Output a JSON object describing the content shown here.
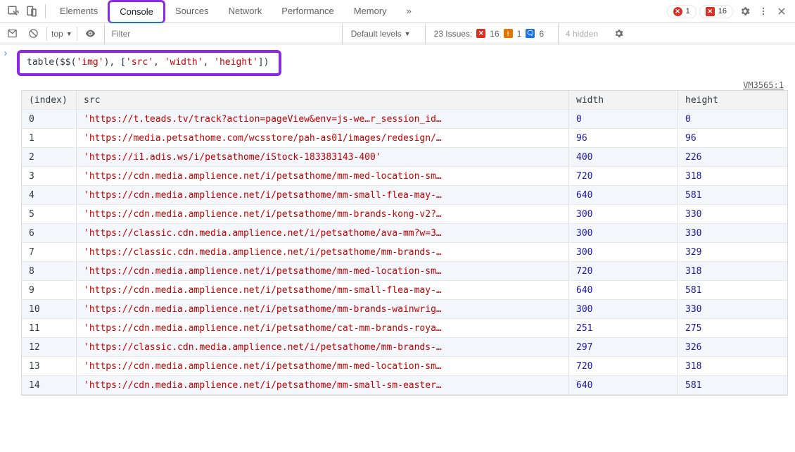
{
  "tabs": {
    "elements": "Elements",
    "console": "Console",
    "sources": "Sources",
    "network": "Network",
    "performance": "Performance",
    "memory": "Memory",
    "more": "»"
  },
  "topPills": {
    "error_count": "1",
    "warn_count": "16"
  },
  "toolbar": {
    "context_label": "top",
    "filter_placeholder": "Filter",
    "levels_label": "Default levels",
    "issues_label": "23 Issues:",
    "issues_err": "16",
    "issues_warn": "1",
    "issues_info": "6",
    "hidden_label": "4 hidden"
  },
  "command": {
    "fn": "table",
    "paren_open": "(",
    "selector_fn": "$$",
    "selector_open": "(",
    "selector_arg": "'img'",
    "selector_close": ")",
    "comma": ", ",
    "arr_open": "[",
    "col1": "'src'",
    "sep1": ", ",
    "col2": "'width'",
    "sep2": ", ",
    "col3": "'height'",
    "arr_close": "]",
    "paren_close": ")"
  },
  "vm_link": "VM3565:1",
  "table": {
    "headers": {
      "index": "(index)",
      "src": "src",
      "width": "width",
      "height": "height"
    },
    "rows": [
      {
        "index": "0",
        "src": "'https://t.teads.tv/track?action=pageView&env=js-we…r_session_id…",
        "width": "0",
        "height": "0"
      },
      {
        "index": "1",
        "src": "'https://media.petsathome.com/wcsstore/pah-as01/images/redesign/…",
        "width": "96",
        "height": "96"
      },
      {
        "index": "2",
        "src": "'https://i1.adis.ws/i/petsathome/iStock-183383143-400'",
        "width": "400",
        "height": "226"
      },
      {
        "index": "3",
        "src": "'https://cdn.media.amplience.net/i/petsathome/mm-med-location-sm…",
        "width": "720",
        "height": "318"
      },
      {
        "index": "4",
        "src": "'https://cdn.media.amplience.net/i/petsathome/mm-small-flea-may-…",
        "width": "640",
        "height": "581"
      },
      {
        "index": "5",
        "src": "'https://cdn.media.amplience.net/i/petsathome/mm-brands-kong-v2?…",
        "width": "300",
        "height": "330"
      },
      {
        "index": "6",
        "src": "'https://classic.cdn.media.amplience.net/i/petsathome/ava-mm?w=3…",
        "width": "300",
        "height": "330"
      },
      {
        "index": "7",
        "src": "'https://classic.cdn.media.amplience.net/i/petsathome/mm-brands-…",
        "width": "300",
        "height": "329"
      },
      {
        "index": "8",
        "src": "'https://cdn.media.amplience.net/i/petsathome/mm-med-location-sm…",
        "width": "720",
        "height": "318"
      },
      {
        "index": "9",
        "src": "'https://cdn.media.amplience.net/i/petsathome/mm-small-flea-may-…",
        "width": "640",
        "height": "581"
      },
      {
        "index": "10",
        "src": "'https://cdn.media.amplience.net/i/petsathome/mm-brands-wainwrig…",
        "width": "300",
        "height": "330"
      },
      {
        "index": "11",
        "src": "'https://cdn.media.amplience.net/i/petsathome/cat-mm-brands-roya…",
        "width": "251",
        "height": "275"
      },
      {
        "index": "12",
        "src": "'https://classic.cdn.media.amplience.net/i/petsathome/mm-brands-…",
        "width": "297",
        "height": "326"
      },
      {
        "index": "13",
        "src": "'https://cdn.media.amplience.net/i/petsathome/mm-med-location-sm…",
        "width": "720",
        "height": "318"
      },
      {
        "index": "14",
        "src": "'https://cdn.media.amplience.net/i/petsathome/mm-small-sm-easter…",
        "width": "640",
        "height": "581"
      }
    ]
  }
}
